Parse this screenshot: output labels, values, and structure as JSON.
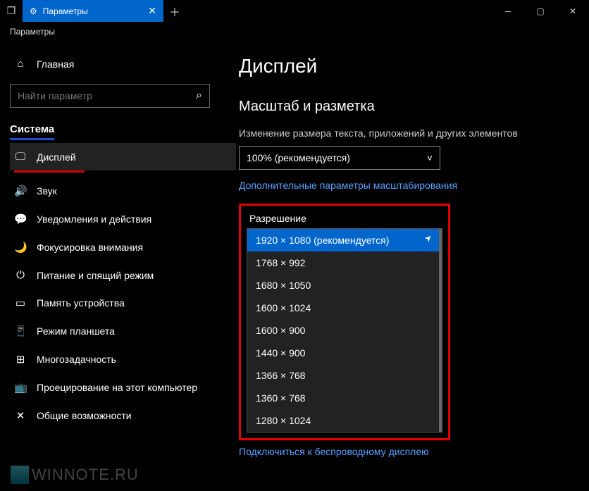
{
  "titlebar": {
    "tab_label": "Параметры",
    "breadcrumb": "Параметры"
  },
  "sidebar": {
    "home": "Главная",
    "search_placeholder": "Найти параметр",
    "section": "Система",
    "items": [
      {
        "label": "Дисплей",
        "icon": "🖵",
        "active": true
      },
      {
        "label": "Звук",
        "icon": "🔊"
      },
      {
        "label": "Уведомления и действия",
        "icon": "💬"
      },
      {
        "label": "Фокусировка внимания",
        "icon": "🌙"
      },
      {
        "label": "Питание и спящий режим",
        "icon": "⏻"
      },
      {
        "label": "Память устройства",
        "icon": "▭"
      },
      {
        "label": "Режим планшета",
        "icon": "📱"
      },
      {
        "label": "Многозадачность",
        "icon": "⊞"
      },
      {
        "label": "Проецирование на этот компьютер",
        "icon": "📺"
      },
      {
        "label": "Общие возможности",
        "icon": "✕"
      }
    ]
  },
  "content": {
    "title": "Дисплей",
    "section": "Масштаб и разметка",
    "scale_label": "Изменение размера текста, приложений и других элементов",
    "scale_value": "100% (рекомендуется)",
    "advanced_link": "Дополнительные параметры масштабирования",
    "resolution_label": "Разрешение",
    "resolutions": [
      "1920 × 1080 (рекомендуется)",
      "1768 × 992",
      "1680 × 1050",
      "1600 × 1024",
      "1600 × 900",
      "1440 × 900",
      "1366 × 768",
      "1360 × 768",
      "1280 × 1024"
    ],
    "wireless_link": "Подключиться к беспроводному дисплею"
  },
  "watermark": "WINNOTE.RU"
}
